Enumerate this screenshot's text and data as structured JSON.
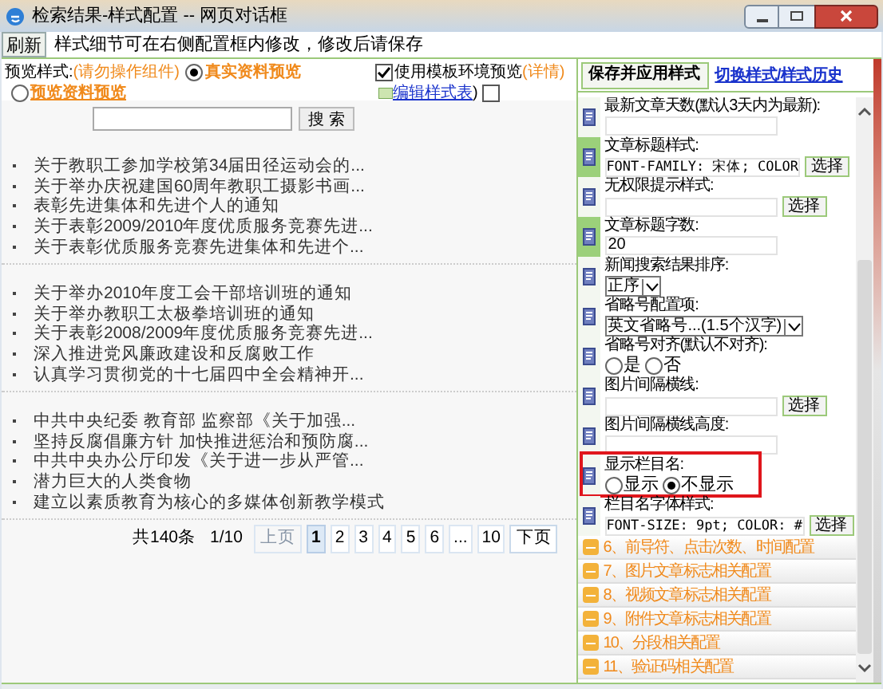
{
  "window": {
    "title": "检索结果-样式配置 -- 网页对话框"
  },
  "toolbar": {
    "refresh": "刷新",
    "hint": "样式细节可在右侧配置框内修改，修改后请保存"
  },
  "options": {
    "label": "预览样式:",
    "warning": "(请勿操作组件)",
    "modes": [
      {
        "label": "真实资料预览",
        "selected": true
      },
      {
        "label": "预览资料预览",
        "selected": false
      }
    ],
    "template": {
      "label": "使用模板环境预览",
      "checked": true,
      "details": "(详情)",
      "link": "编辑样式表",
      "close": ")",
      "extra_checked": false
    }
  },
  "search": {
    "button": "搜 索"
  },
  "groups": [
    [
      "关于教职工参加学校第34届田径运动会的...",
      "关于举办庆祝建国60周年教职工摄影书画...",
      "表彰先进集体和先进个人的通知",
      "关于表彰2009/2010年度优质服务竞赛先进...",
      "关于表彰优质服务竞赛先进集体和先进个..."
    ],
    [
      "关于举办2010年度工会干部培训班的通知",
      "关于举办教职工太极拳培训班的通知",
      "关于表彰2008/2009年度优质服务竞赛先进...",
      "深入推进党风廉政建设和反腐败工作",
      "认真学习贯彻党的十七届四中全会精神开..."
    ],
    [
      "中共中央纪委 教育部 监察部《关于加强...",
      "坚持反腐倡廉方针 加快推进惩治和预防腐...",
      "中共中央办公厅印发《关于进一步从严管...",
      "潜力巨大的人类食物",
      "建立以素质教育为核心的多媒体创新教学模式"
    ]
  ],
  "pager": {
    "total": "共140条",
    "page": "1/10",
    "prev": {
      "label": "上页",
      "disabled": true
    },
    "pages": [
      {
        "label": "1",
        "selected": true
      },
      {
        "label": "2",
        "selected": false
      },
      {
        "label": "3",
        "selected": false
      },
      {
        "label": "4",
        "selected": false
      },
      {
        "label": "5",
        "selected": false
      },
      {
        "label": "6",
        "selected": false
      },
      {
        "label": "...",
        "selected": false
      },
      {
        "label": "10",
        "selected": false
      }
    ],
    "next": {
      "label": "下页",
      "disabled": false
    }
  },
  "panel": {
    "save": "保存并应用样式",
    "switch": "切换样式/样式历史",
    "items": [
      {
        "kind": "input",
        "label": "最新文章天数(默认3天内为最新):",
        "active": false,
        "highlighted": false
      },
      {
        "kind": "style",
        "label": "文章标题样式:",
        "value": "FONT-FAMILY: 宋体; COLOR",
        "button": "选择",
        "active": true,
        "highlighted": false
      },
      {
        "kind": "style",
        "label": "无权限提示样式:",
        "button": "选择",
        "active": false,
        "highlighted": false
      },
      {
        "kind": "input",
        "label": "文章标题字数:",
        "value": "20",
        "active": true,
        "highlighted": false
      },
      {
        "kind": "select",
        "label": "新闻搜索结果排序:",
        "value": "正序",
        "active": false,
        "highlighted": false
      },
      {
        "kind": "select",
        "label": "省略号配置项:",
        "value": "英文省略号...(1.5个汉字)",
        "active": false,
        "highlighted": false
      },
      {
        "kind": "radio",
        "label": "省略号对齐(默认不对齐):",
        "choices": [
          {
            "label": "是",
            "selected": false
          },
          {
            "label": "否",
            "selected": false
          }
        ],
        "active": false,
        "highlighted": false
      },
      {
        "kind": "style",
        "label": "图片间隔横线:",
        "button": "选择",
        "active": false,
        "highlighted": false
      },
      {
        "kind": "input",
        "label": "图片间隔横线高度:",
        "active": false,
        "highlighted": false
      },
      {
        "kind": "radio",
        "label": "显示栏目名:",
        "choices": [
          {
            "label": "显示",
            "selected": false
          },
          {
            "label": "不显示",
            "selected": true
          }
        ],
        "active": false,
        "highlighted": true
      },
      {
        "kind": "style",
        "label": "栏目名字体样式:",
        "value": "FONT-SIZE: 9pt; COLOR: #",
        "button": "选择",
        "active": false,
        "highlighted": false
      }
    ],
    "sections": [
      "6、前导符、点击次数、时间配置",
      "7、图片文章标志相关配置",
      "8、视频文章标志相关配置",
      "9、附件文章标志相关配置",
      "10、分段相关配置",
      "11、验证码相关配置"
    ]
  }
}
